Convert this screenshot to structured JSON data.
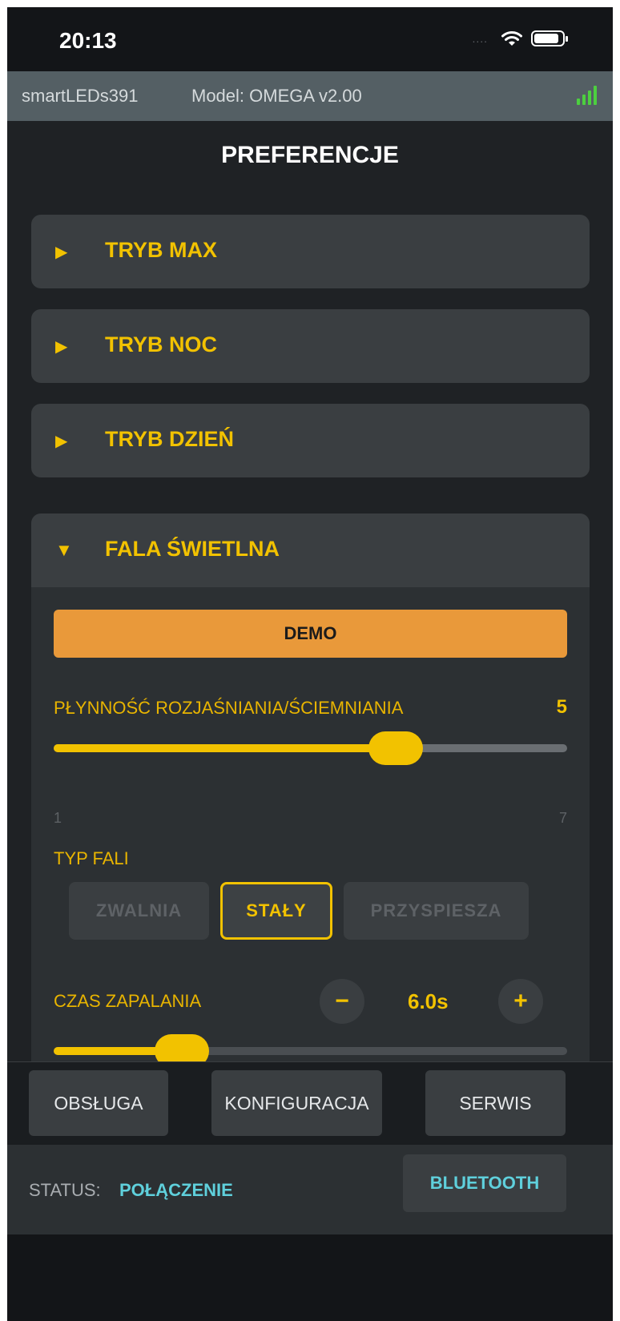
{
  "status_bar": {
    "time": "20:13",
    "signal_dots": "....",
    "icons": [
      "wifi-icon",
      "battery-icon"
    ]
  },
  "device": {
    "name": "smartLEDs391",
    "model": "Model: OMEGA v2.00",
    "signal_icon": "signal-bars-icon"
  },
  "page_title": "PREFERENCJE",
  "sections": [
    {
      "label": "TRYB MAX",
      "expanded": false
    },
    {
      "label": "TRYB NOC",
      "expanded": false
    },
    {
      "label": "TRYB DZIEŃ",
      "expanded": false
    },
    {
      "label": "FALA ŚWIETLNA",
      "expanded": true
    }
  ],
  "wave": {
    "demo_label": "DEMO",
    "smoothness": {
      "label": "PŁYNNOŚĆ ROZJAŚNIANIA/ŚCIEMNIANIA",
      "value": "5",
      "min": "1",
      "max": "7",
      "value_num": 5
    },
    "wave_type": {
      "label": "TYP FALI",
      "options": [
        "ZWALNIA",
        "STAŁY",
        "PRZYSPIESZA"
      ],
      "selected": "STAŁY"
    },
    "on_time": {
      "label": "CZAS ZAPALANIA",
      "value": "6.0s",
      "minus": "−",
      "plus": "+",
      "slider_fraction": 0.25
    }
  },
  "nav": {
    "service": "OBSŁUGA",
    "config": "KONFIGURACJA",
    "maintenance": "SERWIS"
  },
  "status": {
    "label": "STATUS:",
    "value": "POŁĄCZENIE",
    "bluetooth": "BLUETOOTH"
  },
  "colors": {
    "accent": "#f2c200",
    "demo": "#e9993a",
    "status": "#5fd0dc",
    "signal": "#4ccf3f"
  }
}
